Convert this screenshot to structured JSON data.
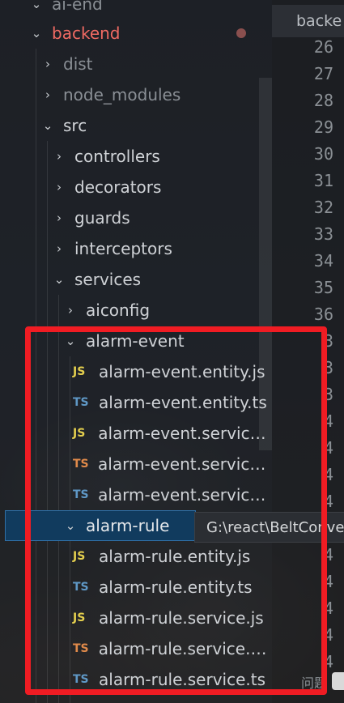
{
  "explorer": {
    "top_item": "ai-end",
    "project": "backend",
    "items": [
      {
        "label": "dist",
        "chevron": ">"
      },
      {
        "label": "node_modules",
        "chevron": ">"
      },
      {
        "label": "src",
        "chevron": "v"
      },
      {
        "label": "controllers",
        "chevron": ">"
      },
      {
        "label": "decorators",
        "chevron": ">"
      },
      {
        "label": "guards",
        "chevron": ">"
      },
      {
        "label": "interceptors",
        "chevron": ">"
      },
      {
        "label": "services",
        "chevron": "v"
      },
      {
        "label": "aiconfig",
        "chevron": ">"
      },
      {
        "label": "alarm-event",
        "chevron": "v"
      }
    ],
    "alarm_event_files": [
      {
        "type": "JS",
        "label": "alarm-event.entity.js"
      },
      {
        "type": "TS",
        "label": "alarm-event.entity.ts"
      },
      {
        "type": "JS",
        "label": "alarm-event.service.js"
      },
      {
        "type": "TS",
        "label": "alarm-event.service...."
      },
      {
        "type": "TS",
        "label": "alarm-event.service.ts"
      }
    ],
    "selected_folder": "alarm-rule",
    "tooltip": "G:\\react\\BeltConve",
    "alarm_rule_files": [
      {
        "type": "JS",
        "label": "alarm-rule.entity.js"
      },
      {
        "type": "TS",
        "label": "alarm-rule.entity.ts"
      },
      {
        "type": "JS",
        "label": "alarm-rule.service.js"
      },
      {
        "type": "TS",
        "label": "alarm-rule.service.s..."
      },
      {
        "type": "TS",
        "label": "alarm-rule.service.ts"
      }
    ]
  },
  "editor": {
    "tab_label": "backe",
    "line_numbers": [
      "26",
      "27",
      "28",
      "29",
      "30",
      "31",
      "32",
      "33",
      "34",
      "35",
      "36",
      "3",
      "3",
      "3",
      "4",
      "4",
      "4",
      "4",
      "4",
      "4",
      "4",
      "4",
      "4",
      "4"
    ]
  },
  "status_text": "问题"
}
